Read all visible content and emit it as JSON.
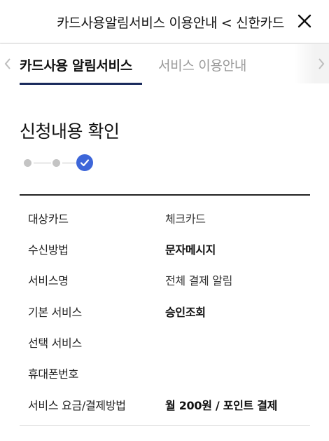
{
  "header": {
    "title": "카드사용알림서비스 이용안내 < 신한카드",
    "close_icon": "close-icon"
  },
  "tabs": [
    {
      "label": "카드사용 알림서비스",
      "active": true
    },
    {
      "label": "서비스 이용안내",
      "active": false
    }
  ],
  "tab_arrows": {
    "left_icon": "chevron-left-icon",
    "right_icon": "chevron-right-icon"
  },
  "section": {
    "title": "신청내용 확인"
  },
  "stepper": {
    "total_steps": 3,
    "current_step": 3,
    "done_icon": "check-icon",
    "accent_color": "#3d66d9"
  },
  "details": [
    {
      "label": "대상카드",
      "value": "체크카드",
      "bold": false
    },
    {
      "label": "수신방법",
      "value": "문자메시지",
      "bold": true
    },
    {
      "label": "서비스명",
      "value": "전체 결제 알림",
      "bold": false
    },
    {
      "label": "기본 서비스",
      "value": "승인조회",
      "bold": true
    },
    {
      "label": "선택 서비스",
      "value": "",
      "bold": false
    },
    {
      "label": "휴대폰번호",
      "value": "",
      "bold": false
    },
    {
      "label": "서비스 요금/결제방법",
      "value": "월 200원 / 포인트 결제",
      "bold": true
    }
  ]
}
